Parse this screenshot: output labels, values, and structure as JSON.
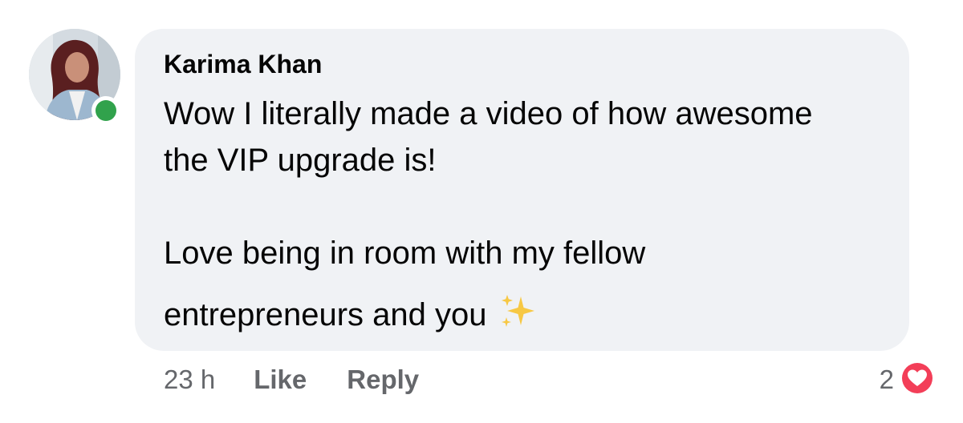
{
  "comment": {
    "author": "Karima Khan",
    "lines": [
      "Wow I literally made a video of how awesome",
      "the VIP upgrade is!",
      "Love being in room with my fellow",
      "entrepreneurs and you"
    ],
    "emoji": "sparkles-icon",
    "timestamp": "23 h",
    "like_label": "Like",
    "reply_label": "Reply",
    "reaction_count": "2",
    "reaction_icon": "heart-icon"
  },
  "colors": {
    "bubble": "#f0f2f5",
    "online": "#31a24c",
    "heart": "#f33e58",
    "muted_text": "#65676b"
  }
}
